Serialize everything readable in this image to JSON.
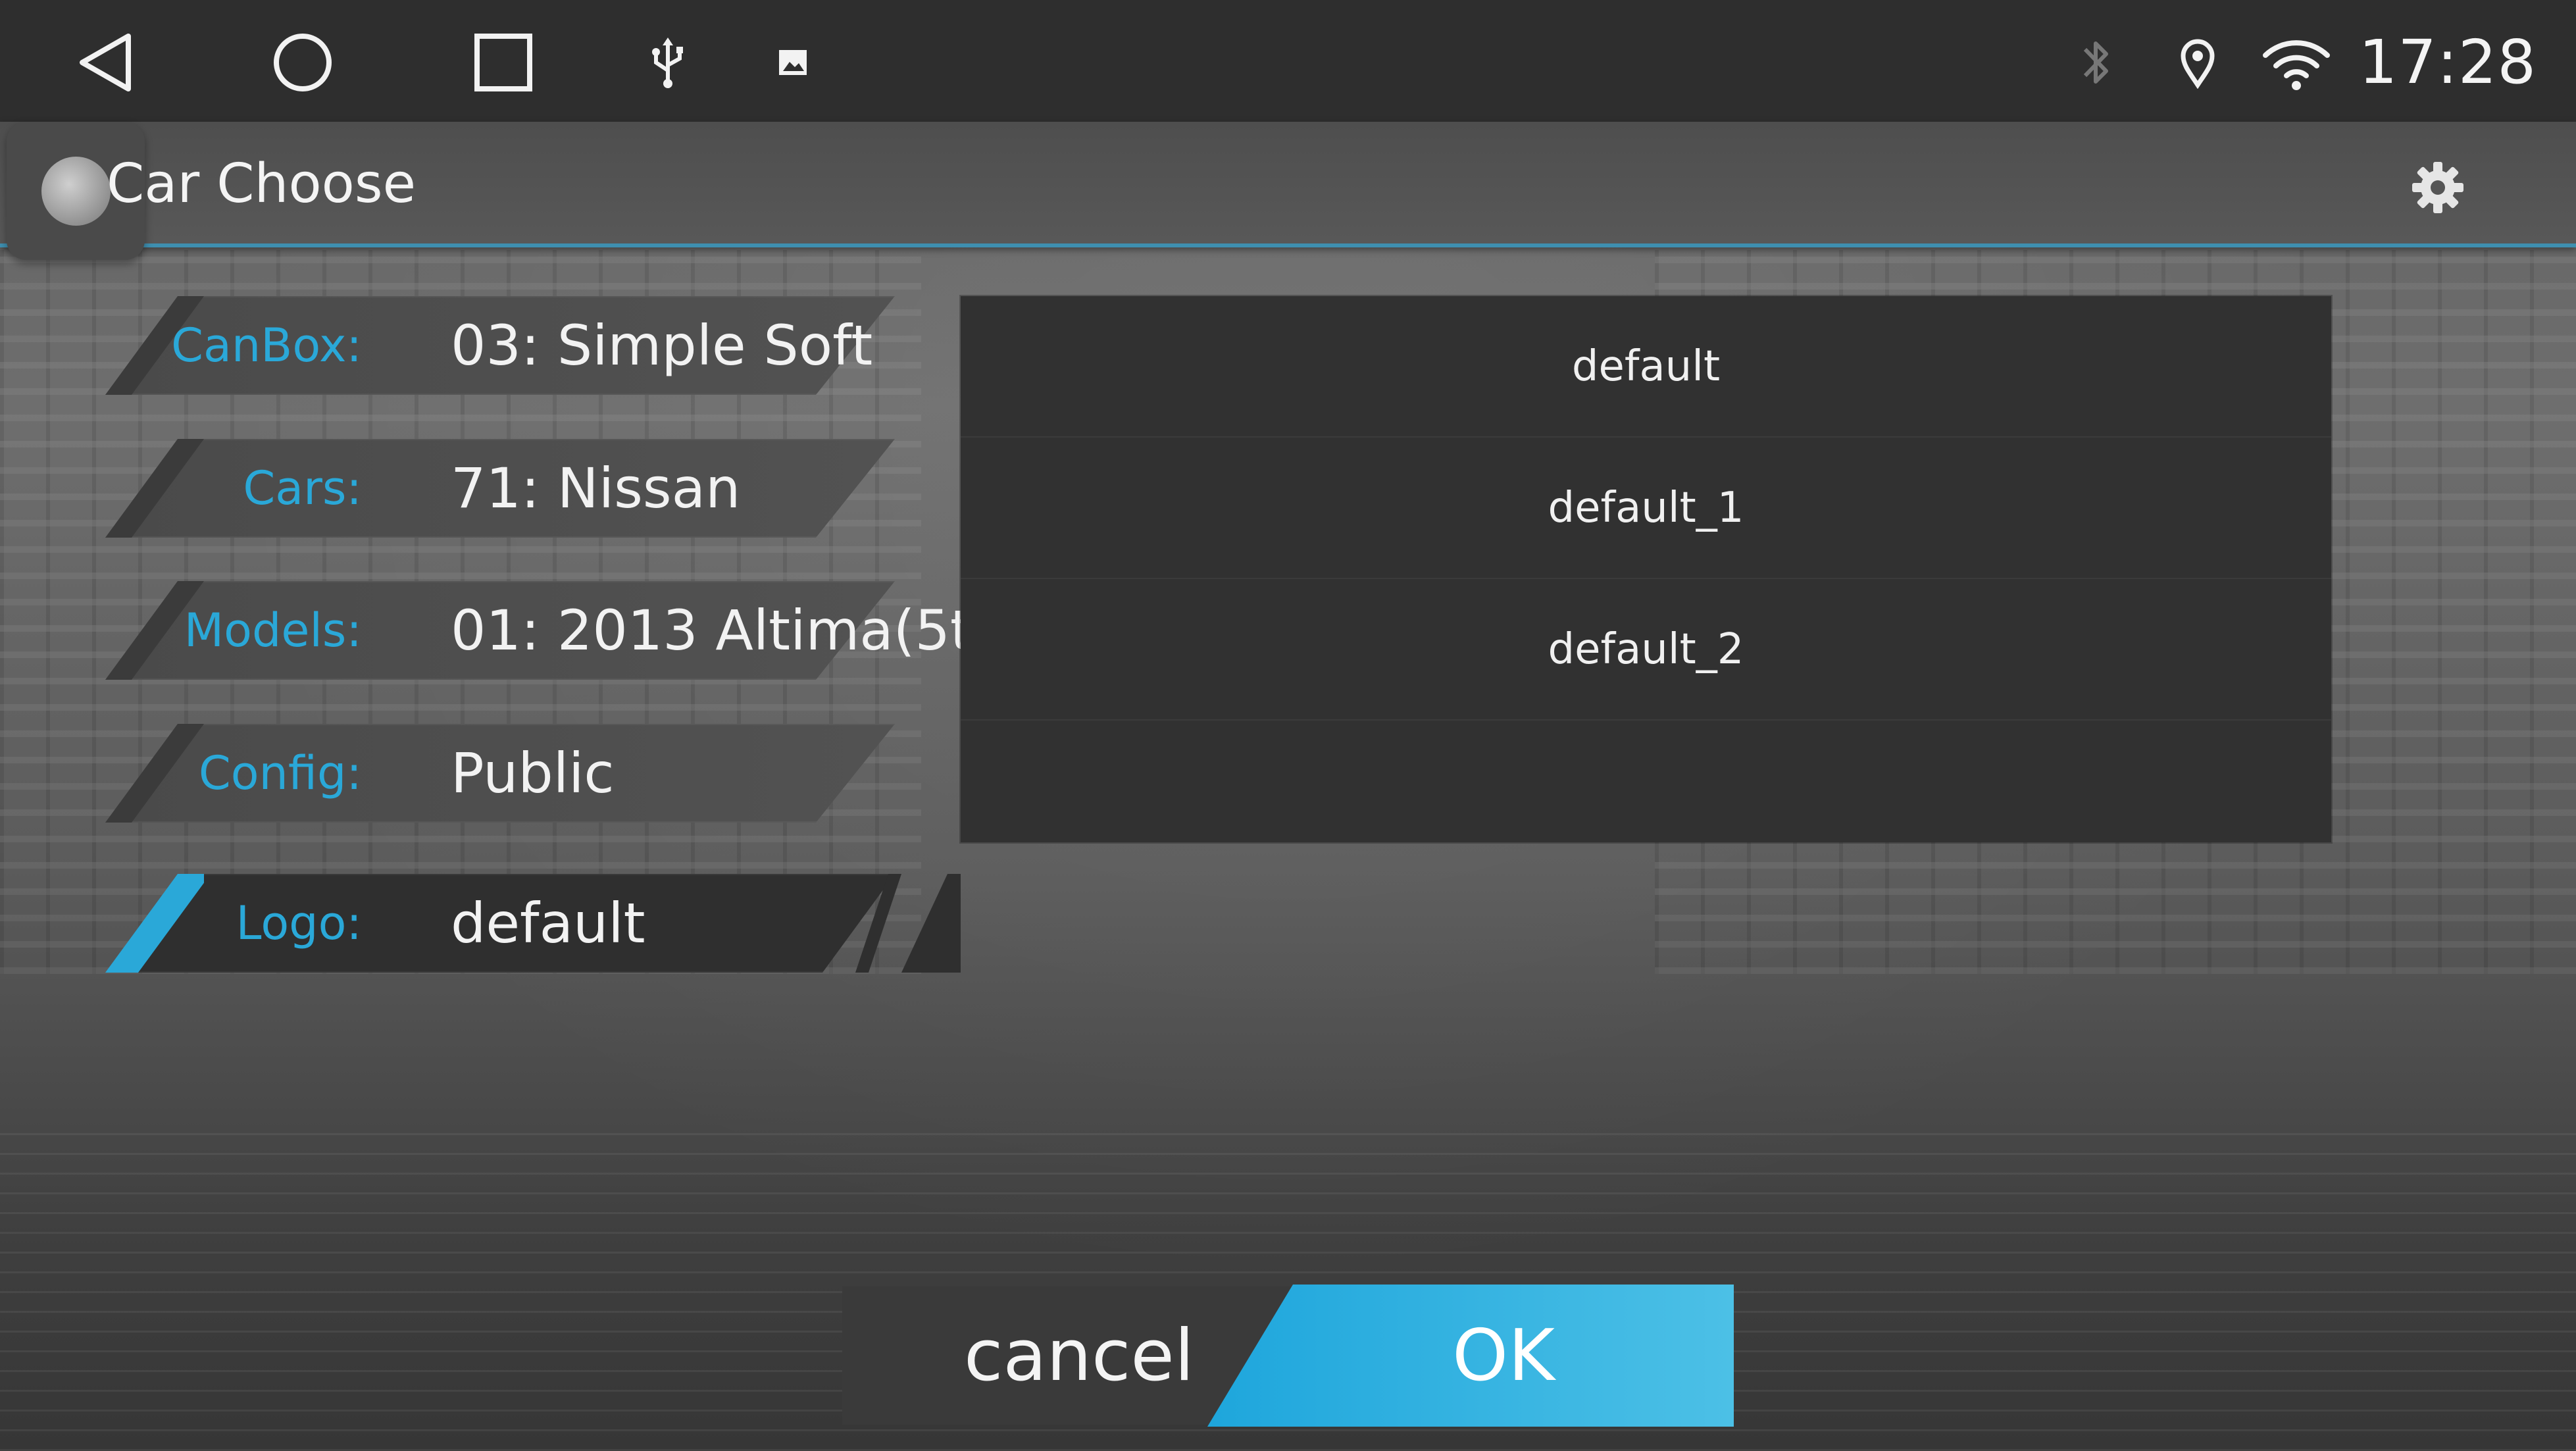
{
  "status_bar": {
    "time": "17:28",
    "nav_icons": [
      "back-icon",
      "home-icon",
      "recents-icon"
    ],
    "notification_icons": [
      "usb-icon",
      "image-icon"
    ],
    "status_icons": [
      "bluetooth-icon",
      "location-icon",
      "wifi-icon"
    ]
  },
  "header": {
    "title": "Car Choose",
    "settings_icon": "gear-icon"
  },
  "settings": {
    "rows": [
      {
        "label": "CanBox:",
        "value": "03: Simple Soft"
      },
      {
        "label": "Cars:",
        "value": "71: Nissan"
      },
      {
        "label": "Models:",
        "value": "01: 2013 Altima(5t..."
      },
      {
        "label": "Config:",
        "value": "Public"
      },
      {
        "label": "Logo:",
        "value": "default"
      }
    ],
    "selected_row": "Logo:"
  },
  "logo_list": {
    "items": [
      "default",
      "default_1",
      "default_2"
    ]
  },
  "buttons": {
    "cancel_label": "cancel",
    "ok_label": "OK"
  },
  "colors": {
    "accent": "#2aa8d8",
    "ok_button": "#1ea6dc",
    "status_bar": "#2e2e2e",
    "list_bg": "#313131"
  }
}
